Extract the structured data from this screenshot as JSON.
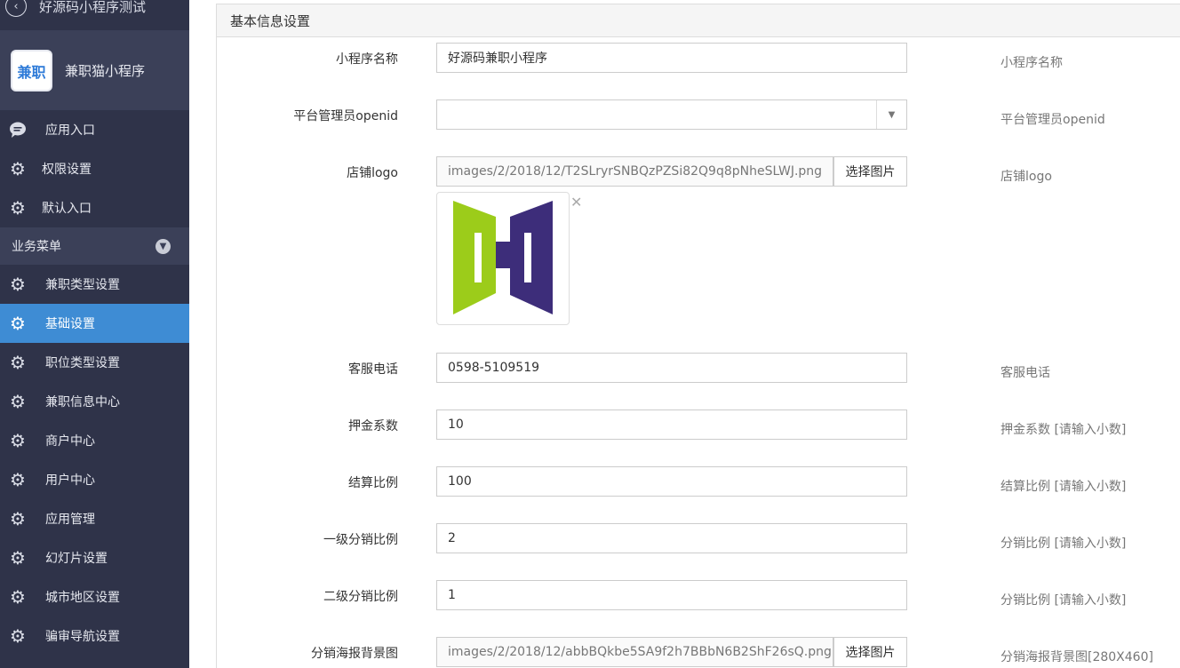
{
  "sidebar": {
    "top_title": "好源码小程序测试",
    "app": {
      "name": "兼职猫小程序",
      "logo_text": "兼职"
    },
    "top_items": [
      {
        "label": "应用入口",
        "icon": "chat-icon"
      },
      {
        "label": "权限设置",
        "icon": "gear-icon"
      },
      {
        "label": "默认入口",
        "icon": "gear-icon"
      }
    ],
    "section_label": "业务菜单",
    "menu_items": [
      {
        "label": "兼职类型设置",
        "icon": "gear-icon",
        "active": false
      },
      {
        "label": "基础设置",
        "icon": "gear-icon",
        "active": true
      },
      {
        "label": "职位类型设置",
        "icon": "gear-icon",
        "active": false
      },
      {
        "label": "兼职信息中心",
        "icon": "gear-icon",
        "active": false
      },
      {
        "label": "商户中心",
        "icon": "gear-icon",
        "active": false
      },
      {
        "label": "用户中心",
        "icon": "gear-icon",
        "active": false
      },
      {
        "label": "应用管理",
        "icon": "gear-icon",
        "active": false
      },
      {
        "label": "幻灯片设置",
        "icon": "gear-icon",
        "active": false
      },
      {
        "label": "城市地区设置",
        "icon": "gear-icon",
        "active": false
      },
      {
        "label": "骗审导航设置",
        "icon": "gear-icon",
        "active": false
      }
    ]
  },
  "panel": {
    "title": "基本信息设置",
    "fields": {
      "app_name": {
        "label": "小程序名称",
        "value": "好源码兼职小程序",
        "hint": "小程序名称"
      },
      "admin_openid": {
        "label": "平台管理员openid",
        "value": "",
        "hint": "平台管理员openid"
      },
      "shop_logo": {
        "label": "店铺logo",
        "value": "images/2/2018/12/T2SLryrSNBQzPZSi82Q9q8pNheSLWJ.png",
        "button": "选择图片",
        "hint": "店铺logo"
      },
      "phone": {
        "label": "客服电话",
        "value": "0598-5109519",
        "hint": "客服电话"
      },
      "deposit": {
        "label": "押金系数",
        "value": "10",
        "hint": "押金系数 [请输入小数]"
      },
      "settle": {
        "label": "结算比例",
        "value": "100",
        "hint": "结算比例 [请输入小数]"
      },
      "level1": {
        "label": "一级分销比例",
        "value": "2",
        "hint": "分销比例 [请输入小数]"
      },
      "level2": {
        "label": "二级分销比例",
        "value": "1",
        "hint": "分销比例 [请输入小数]"
      },
      "poster_bg": {
        "label": "分销海报背景图",
        "value": "images/2/2018/12/abbBQkbe5SA9f2h7BBbN6B2ShF26sQ.png",
        "button": "选择图片",
        "hint": "分销海报背景图[280X460]"
      }
    }
  },
  "colors": {
    "sidebar_bg": "#2f3349",
    "sidebar_section_bg": "#3b4058",
    "active_item": "#3e8cd4",
    "logo_green": "#9ccc1a",
    "logo_purple": "#3d2d7a"
  }
}
